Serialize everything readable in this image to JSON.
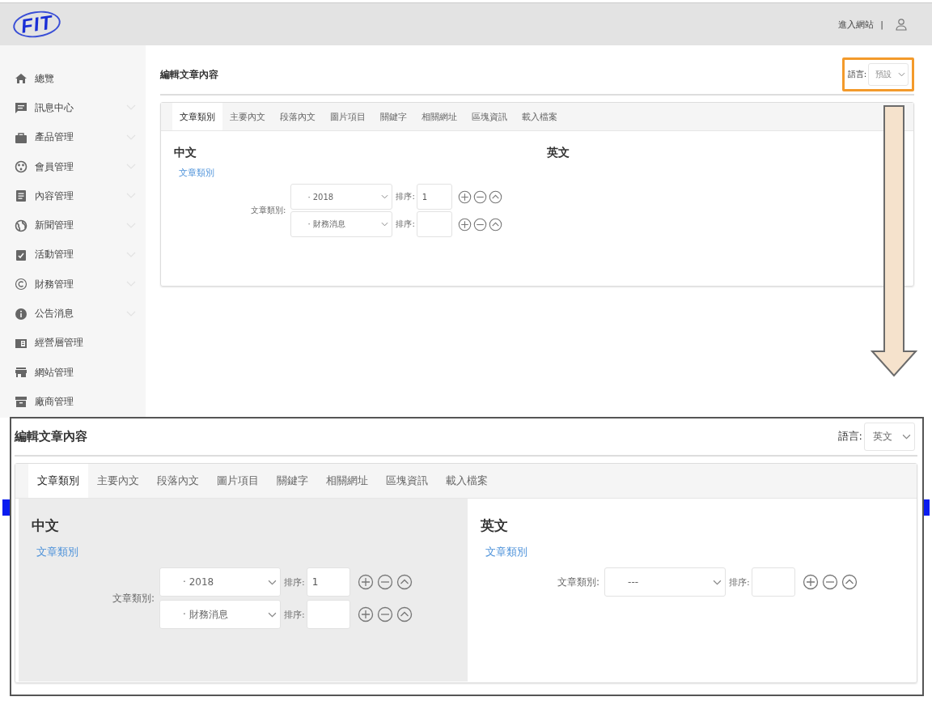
{
  "header": {
    "logo": "FIT",
    "link": "進入網站",
    "separator": "|"
  },
  "sidebar": {
    "items": [
      {
        "label": "總覽",
        "kind": "home",
        "has_submenu": false
      },
      {
        "label": "訊息中心",
        "kind": "chat",
        "has_submenu": true
      },
      {
        "label": "產品管理",
        "kind": "briefcase",
        "has_submenu": true
      },
      {
        "label": "會員管理",
        "kind": "palette",
        "has_submenu": true
      },
      {
        "label": "內容管理",
        "kind": "document",
        "has_submenu": true
      },
      {
        "label": "新聞管理",
        "kind": "globe",
        "has_submenu": true
      },
      {
        "label": "活動管理",
        "kind": "clipboard",
        "has_submenu": true
      },
      {
        "label": "財務管理",
        "kind": "copyright",
        "has_submenu": true
      },
      {
        "label": "公告消息",
        "kind": "info",
        "has_submenu": true
      },
      {
        "label": "經營層管理",
        "kind": "newspaper",
        "has_submenu": false
      },
      {
        "label": "網站管理",
        "kind": "store",
        "has_submenu": false
      },
      {
        "label": "廠商管理",
        "kind": "archive",
        "has_submenu": false
      }
    ]
  },
  "main": {
    "title": "編輯文章內容",
    "language": {
      "label": "語言:",
      "value": "預設",
      "highlighted": true
    },
    "tabs": [
      {
        "label": "文章類別",
        "selected": true
      },
      {
        "label": "主要內文",
        "selected": false
      },
      {
        "label": "段落內文",
        "selected": false
      },
      {
        "label": "圖片項目",
        "selected": false
      },
      {
        "label": "關鍵字",
        "selected": false
      },
      {
        "label": "相關網址",
        "selected": false
      },
      {
        "label": "區塊資訊",
        "selected": false
      },
      {
        "label": "載入檔案",
        "selected": false
      }
    ],
    "columns": [
      {
        "heading": "中文",
        "shaded": false,
        "link": "文章類別",
        "field_label": "文章類別:",
        "rows": [
          {
            "value": "· 2018",
            "order_label": "排序:",
            "order": "1"
          },
          {
            "value": "· 財務消息",
            "order_label": "排序:"
          }
        ]
      },
      {
        "heading": "英文",
        "shaded": false
      }
    ]
  },
  "zoomed_view": {
    "title": "編輯文章內容",
    "language": {
      "label": "語言:",
      "value": "英文",
      "highlighted": false
    },
    "tabs": [
      {
        "label": "文章類別",
        "selected": true
      },
      {
        "label": "主要內文",
        "selected": false
      },
      {
        "label": "段落內文",
        "selected": false
      },
      {
        "label": "圖片項目",
        "selected": false
      },
      {
        "label": "關鍵字",
        "selected": false
      },
      {
        "label": "相關網址",
        "selected": false
      },
      {
        "label": "區塊資訊",
        "selected": false
      },
      {
        "label": "載入檔案",
        "selected": false
      }
    ],
    "columns": [
      {
        "heading": "中文",
        "shaded": true,
        "link": "文章類別",
        "field_label": "文章類別:",
        "rows": [
          {
            "value": "· 2018",
            "order_label": "排序:",
            "order": "1"
          },
          {
            "value": "· 財務消息",
            "order_label": "排序:"
          }
        ]
      },
      {
        "heading": "英文",
        "shaded": false,
        "link": "文章類別",
        "field_label": "文章類別:",
        "rows": [
          {
            "value": "---",
            "order_label": "排序:"
          }
        ]
      }
    ]
  }
}
